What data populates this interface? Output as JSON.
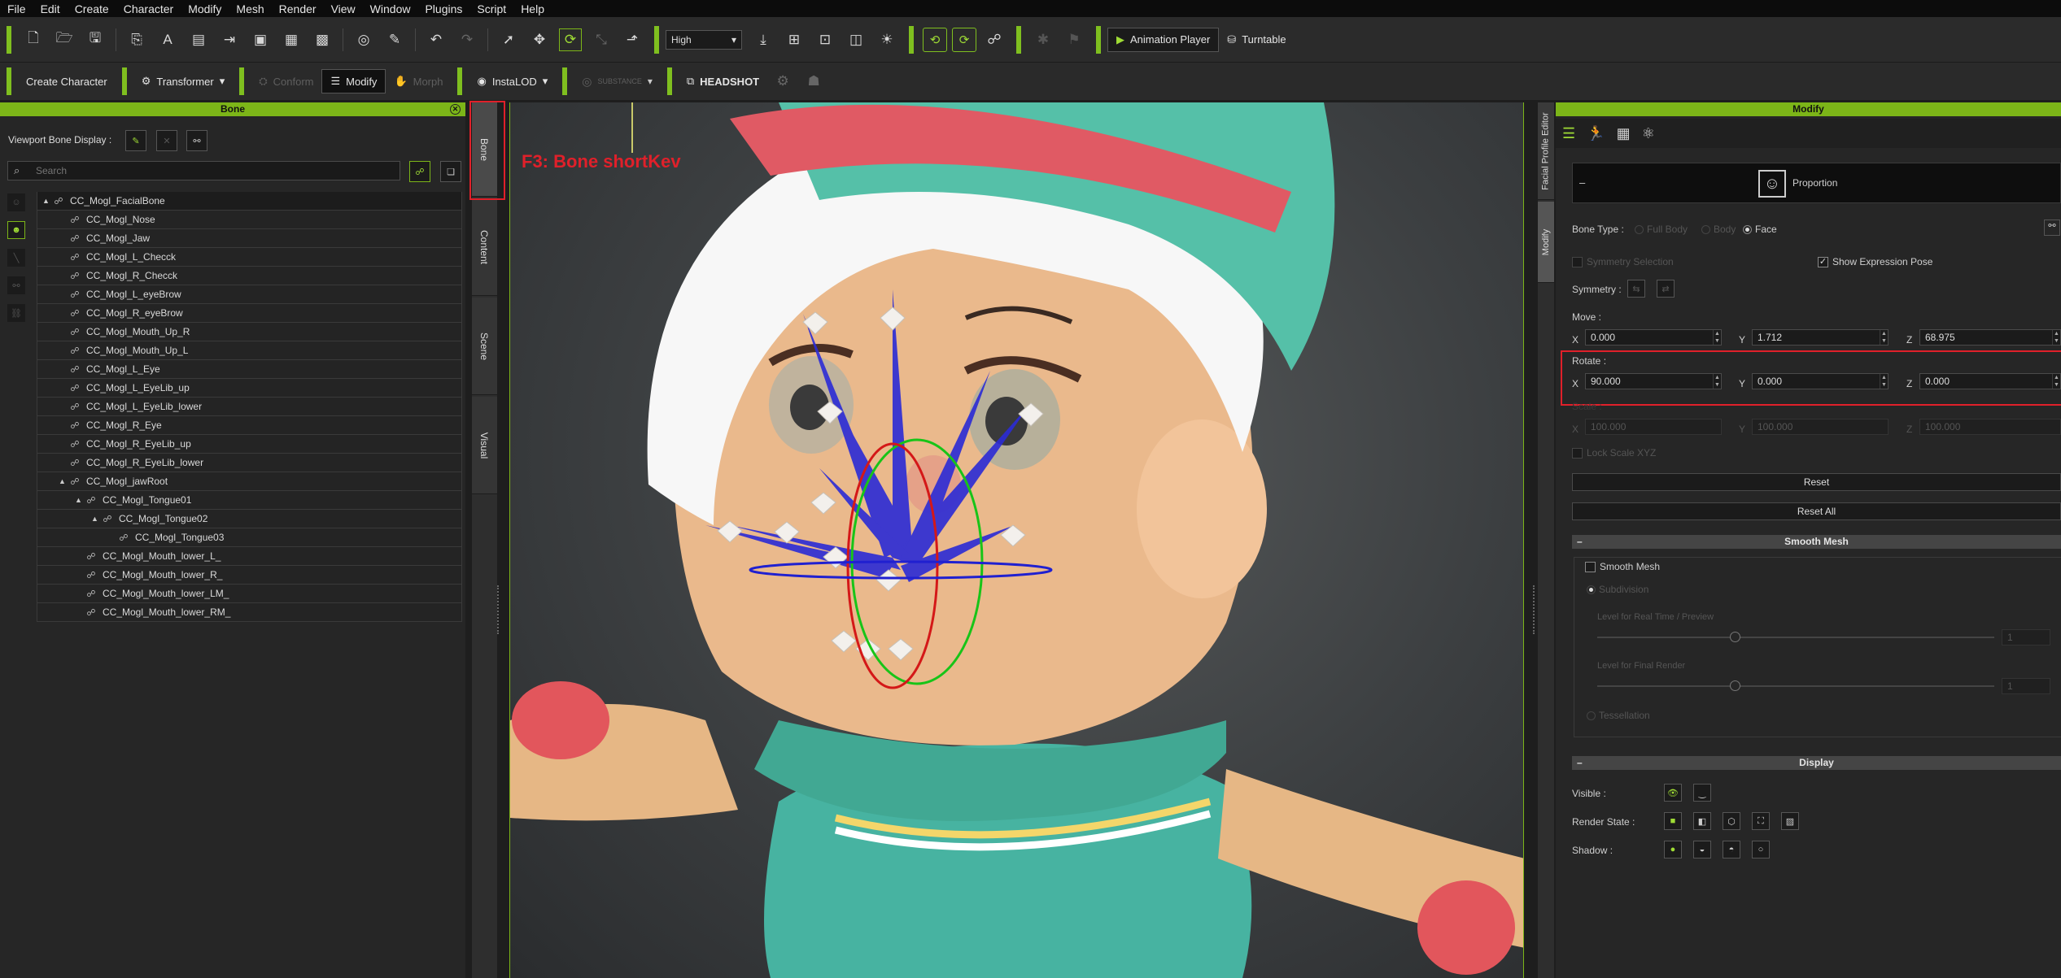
{
  "menu": [
    "File",
    "Edit",
    "Create",
    "Character",
    "Modify",
    "Mesh",
    "Render",
    "View",
    "Window",
    "Plugins",
    "Script",
    "Help"
  ],
  "toolbar1": {
    "quality_select": "High",
    "animation_player": "Animation Player",
    "turntable": "Turntable"
  },
  "toolbar2": {
    "create_character": "Create Character",
    "transformer": "Transformer",
    "conform": "Conform",
    "modify": "Modify",
    "morph": "Morph",
    "instalod": "InstaLOD",
    "substance": "SUBSTANCE",
    "headshot": "HEADSHOT"
  },
  "bone_panel": {
    "title": "Bone",
    "viewport_bone_display": "Viewport Bone Display :",
    "search_placeholder": "Search",
    "tree": [
      {
        "label": "CC_Mogl_FacialBone",
        "depth": 0,
        "expand": "▲"
      },
      {
        "label": "CC_Mogl_Nose",
        "depth": 1,
        "expand": ""
      },
      {
        "label": "CC_Mogl_Jaw",
        "depth": 1,
        "expand": ""
      },
      {
        "label": "CC_Mogl_L_Checck",
        "depth": 1,
        "expand": ""
      },
      {
        "label": "CC_Mogl_R_Checck",
        "depth": 1,
        "expand": ""
      },
      {
        "label": "CC_Mogl_L_eyeBrow",
        "depth": 1,
        "expand": ""
      },
      {
        "label": "CC_Mogl_R_eyeBrow",
        "depth": 1,
        "expand": ""
      },
      {
        "label": "CC_Mogl_Mouth_Up_R",
        "depth": 1,
        "expand": ""
      },
      {
        "label": "CC_Mogl_Mouth_Up_L",
        "depth": 1,
        "expand": ""
      },
      {
        "label": "CC_Mogl_L_Eye",
        "depth": 1,
        "expand": ""
      },
      {
        "label": "CC_Mogl_L_EyeLib_up",
        "depth": 1,
        "expand": ""
      },
      {
        "label": "CC_Mogl_L_EyeLib_lower",
        "depth": 1,
        "expand": ""
      },
      {
        "label": "CC_Mogl_R_Eye",
        "depth": 1,
        "expand": ""
      },
      {
        "label": "CC_Mogl_R_EyeLib_up",
        "depth": 1,
        "expand": ""
      },
      {
        "label": "CC_Mogl_R_EyeLib_lower",
        "depth": 1,
        "expand": ""
      },
      {
        "label": "CC_Mogl_jawRoot",
        "depth": 1,
        "expand": "▲"
      },
      {
        "label": "CC_Mogl_Tongue01",
        "depth": 2,
        "expand": "▲"
      },
      {
        "label": "CC_Mogl_Tongue02",
        "depth": 3,
        "expand": "▲"
      },
      {
        "label": "CC_Mogl_Tongue03",
        "depth": 4,
        "expand": ""
      },
      {
        "label": "CC_Mogl_Mouth_lower_L_",
        "depth": 2,
        "expand": ""
      },
      {
        "label": "CC_Mogl_Mouth_lower_R_",
        "depth": 2,
        "expand": ""
      },
      {
        "label": "CC_Mogl_Mouth_lower_LM_",
        "depth": 2,
        "expand": ""
      },
      {
        "label": "CC_Mogl_Mouth_lower_RM_",
        "depth": 2,
        "expand": ""
      }
    ]
  },
  "side_tabs": [
    "Bone",
    "Content",
    "Scene",
    "Visual"
  ],
  "annotation": "F3: Bone shortKev",
  "right_tabs": [
    "Facial Profile Editor",
    "Modify"
  ],
  "modify_panel": {
    "title": "Modify",
    "proportion": "Proportion",
    "bone_type_label": "Bone Type :",
    "bone_type_options": [
      "Full Body",
      "Body",
      "Face"
    ],
    "symmetry_selection": "Symmetry Selection",
    "show_expression_pose": "Show Expression Pose",
    "symmetry_label": "Symmetry :",
    "move_label": "Move :",
    "move": {
      "x": "0.000",
      "y": "1.712",
      "z": "68.975"
    },
    "rotate_label": "Rotate :",
    "rotate": {
      "x": "90.000",
      "y": "0.000",
      "z": "0.000"
    },
    "scale_label": "Scale :",
    "scale": {
      "x": "100.000",
      "y": "100.000",
      "z": "100.000"
    },
    "lock_scale": "Lock Scale XYZ",
    "reset": "Reset",
    "reset_all": "Reset All",
    "smooth_mesh_section": "Smooth Mesh",
    "smooth_mesh": "Smooth Mesh",
    "subdivision": "Subdivision",
    "level_realtime": "Level for Real Time / Preview",
    "level_realtime_value": "1",
    "level_final": "Level for Final Render",
    "level_final_value": "1",
    "tessellation": "Tessellation",
    "display_section": "Display",
    "visible_label": "Visible :",
    "render_state_label": "Render State :",
    "shadow_label": "Shadow :"
  },
  "axis_labels": {
    "x": "X",
    "y": "Y",
    "z": "Z"
  },
  "colors": {
    "accent": "#7cb518",
    "highlight_box": "#e0202a",
    "annotation_text": "#e0202a"
  }
}
